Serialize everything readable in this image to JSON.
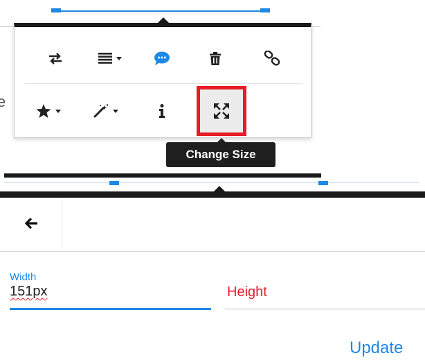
{
  "colors": {
    "accent": "#1e88e5",
    "toolbar_border": "#1a1a1a",
    "highlight_box": "#e81c24",
    "error_text": "#e81c24",
    "tooltip_bg": "#1f1f1f"
  },
  "background_text": {
    "edge_char": "e"
  },
  "image_toolbar": {
    "row1": [
      {
        "icon": "replace-icon",
        "label": "Replace"
      },
      {
        "icon": "align-icon",
        "label": "Align",
        "dropdown": true
      },
      {
        "icon": "comment-icon",
        "label": "Caption"
      },
      {
        "icon": "trash-icon",
        "label": "Remove"
      },
      {
        "icon": "link-icon",
        "label": "Insert Link"
      }
    ],
    "row2": [
      {
        "icon": "star-icon",
        "label": "Display",
        "dropdown": true
      },
      {
        "icon": "magic-wand-icon",
        "label": "Style",
        "dropdown": true
      },
      {
        "icon": "info-icon",
        "label": "Alternative Text"
      },
      {
        "icon": "expand-icon",
        "label": "Change Size",
        "active": true
      }
    ]
  },
  "tooltip": {
    "text": "Change Size"
  },
  "resize_panel": {
    "back_icon": "arrow-left-icon",
    "width_label": "Width",
    "width_value": "151px",
    "height_placeholder": "Height",
    "update_label": "Update"
  }
}
